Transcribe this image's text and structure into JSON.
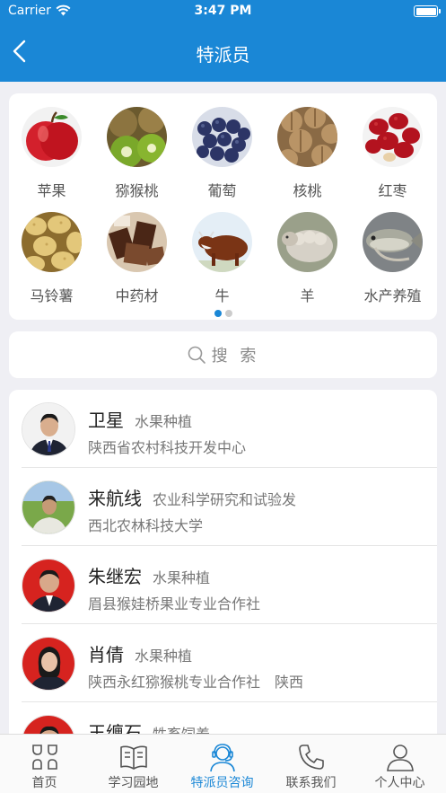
{
  "status_bar": {
    "carrier": "Carrier",
    "time": "3:47 PM"
  },
  "nav": {
    "title": "特派员"
  },
  "categories": [
    {
      "label": "苹果",
      "icon": "apple-image"
    },
    {
      "label": "猕猴桃",
      "icon": "kiwi-image"
    },
    {
      "label": "葡萄",
      "icon": "grape-image"
    },
    {
      "label": "核桃",
      "icon": "walnut-image"
    },
    {
      "label": "红枣",
      "icon": "jujube-image"
    },
    {
      "label": "马铃薯",
      "icon": "potato-image"
    },
    {
      "label": "中药材",
      "icon": "herb-image"
    },
    {
      "label": "牛",
      "icon": "cow-image"
    },
    {
      "label": "羊",
      "icon": "sheep-image"
    },
    {
      "label": "水产养殖",
      "icon": "fish-image"
    }
  ],
  "pager": {
    "pages": 2,
    "active": 1
  },
  "search": {
    "placeholder": "搜 索"
  },
  "experts": [
    {
      "name": "卫星",
      "field": "水果种植",
      "org": "陕西省农村科技开发中心"
    },
    {
      "name": "来航线",
      "field": "农业科学研究和试验发",
      "org": "西北农林科技大学"
    },
    {
      "name": "朱继宏",
      "field": "水果种植",
      "org": "眉县猴娃桥果业专业合作社"
    },
    {
      "name": "肖倩",
      "field": "水果种植",
      "org": "陕西永红猕猴桃专业合作社　陕西"
    },
    {
      "name": "王缠石",
      "field": "牲畜饲养",
      "org": ""
    }
  ],
  "tabs": [
    {
      "label": "首页",
      "icon": "home-grid-icon"
    },
    {
      "label": "学习园地",
      "icon": "book-icon"
    },
    {
      "label": "特派员咨询",
      "icon": "consultant-headset-icon",
      "active": true
    },
    {
      "label": "联系我们",
      "icon": "phone-icon"
    },
    {
      "label": "个人中心",
      "icon": "person-icon"
    }
  ],
  "colors": {
    "primary": "#1a87d6",
    "background": "#efeff4"
  }
}
